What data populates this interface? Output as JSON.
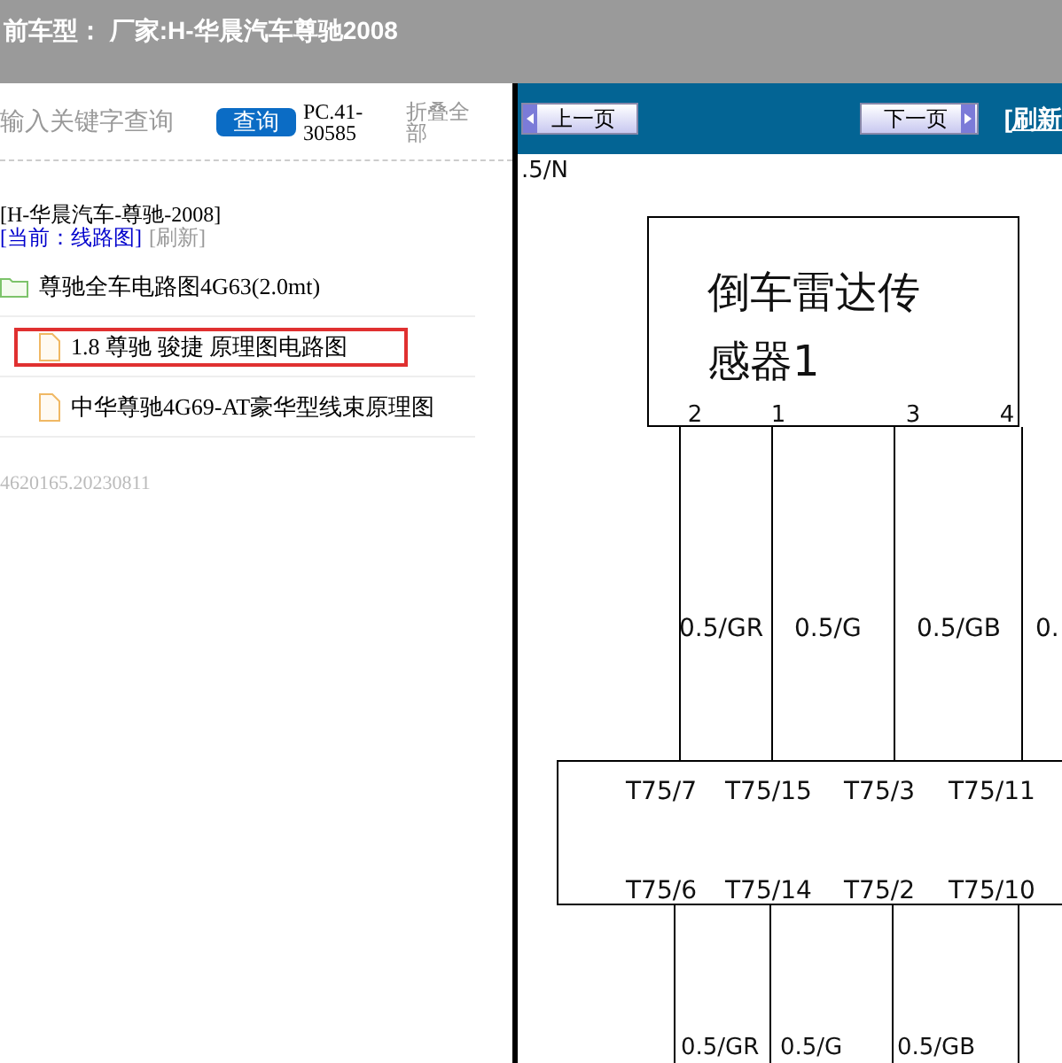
{
  "header": {
    "title": "前车型： 厂家:H-华晨汽车尊驰2008"
  },
  "sidebar": {
    "search": {
      "placeholder": "输入关键字查询",
      "button": "查询"
    },
    "code": "PC.41-30585",
    "collapse": "折叠全部",
    "breadcrumb": "[H-华晨汽车-尊驰-2008]",
    "current": "[当前：线路图]",
    "refresh": "[刷新]",
    "tree": [
      {
        "kind": "folder",
        "label": "尊驰全车电路图4G63(2.0mt)",
        "selected": false,
        "children": [
          {
            "kind": "file",
            "label": "1.8 尊驰 骏捷 原理图电路图",
            "selected": true
          },
          {
            "kind": "file",
            "label": "中华尊驰4G69-AT豪华型线束原理图",
            "selected": false
          }
        ]
      }
    ],
    "footer": "4620165.20230811"
  },
  "toolbar": {
    "prev": "上一页",
    "next": "下一页",
    "refresh": "[刷新"
  },
  "diagram": {
    "corner_label": ".5/N",
    "component": [
      "倒车雷达传",
      "感器1"
    ],
    "pins": [
      "2",
      "1",
      "3",
      "4"
    ],
    "upper_wires": [
      "0.5/GR",
      "0.5/G",
      "0.5/GB",
      "0."
    ],
    "connector_top": [
      "T75/7",
      "T75/15",
      "T75/3",
      "T75/11"
    ],
    "connector_bottom": [
      "T75/6",
      "T75/14",
      "T75/2",
      "T75/10"
    ],
    "lower_wires": [
      "0.5/GR",
      "0.5/G",
      "0.5/GB"
    ]
  }
}
